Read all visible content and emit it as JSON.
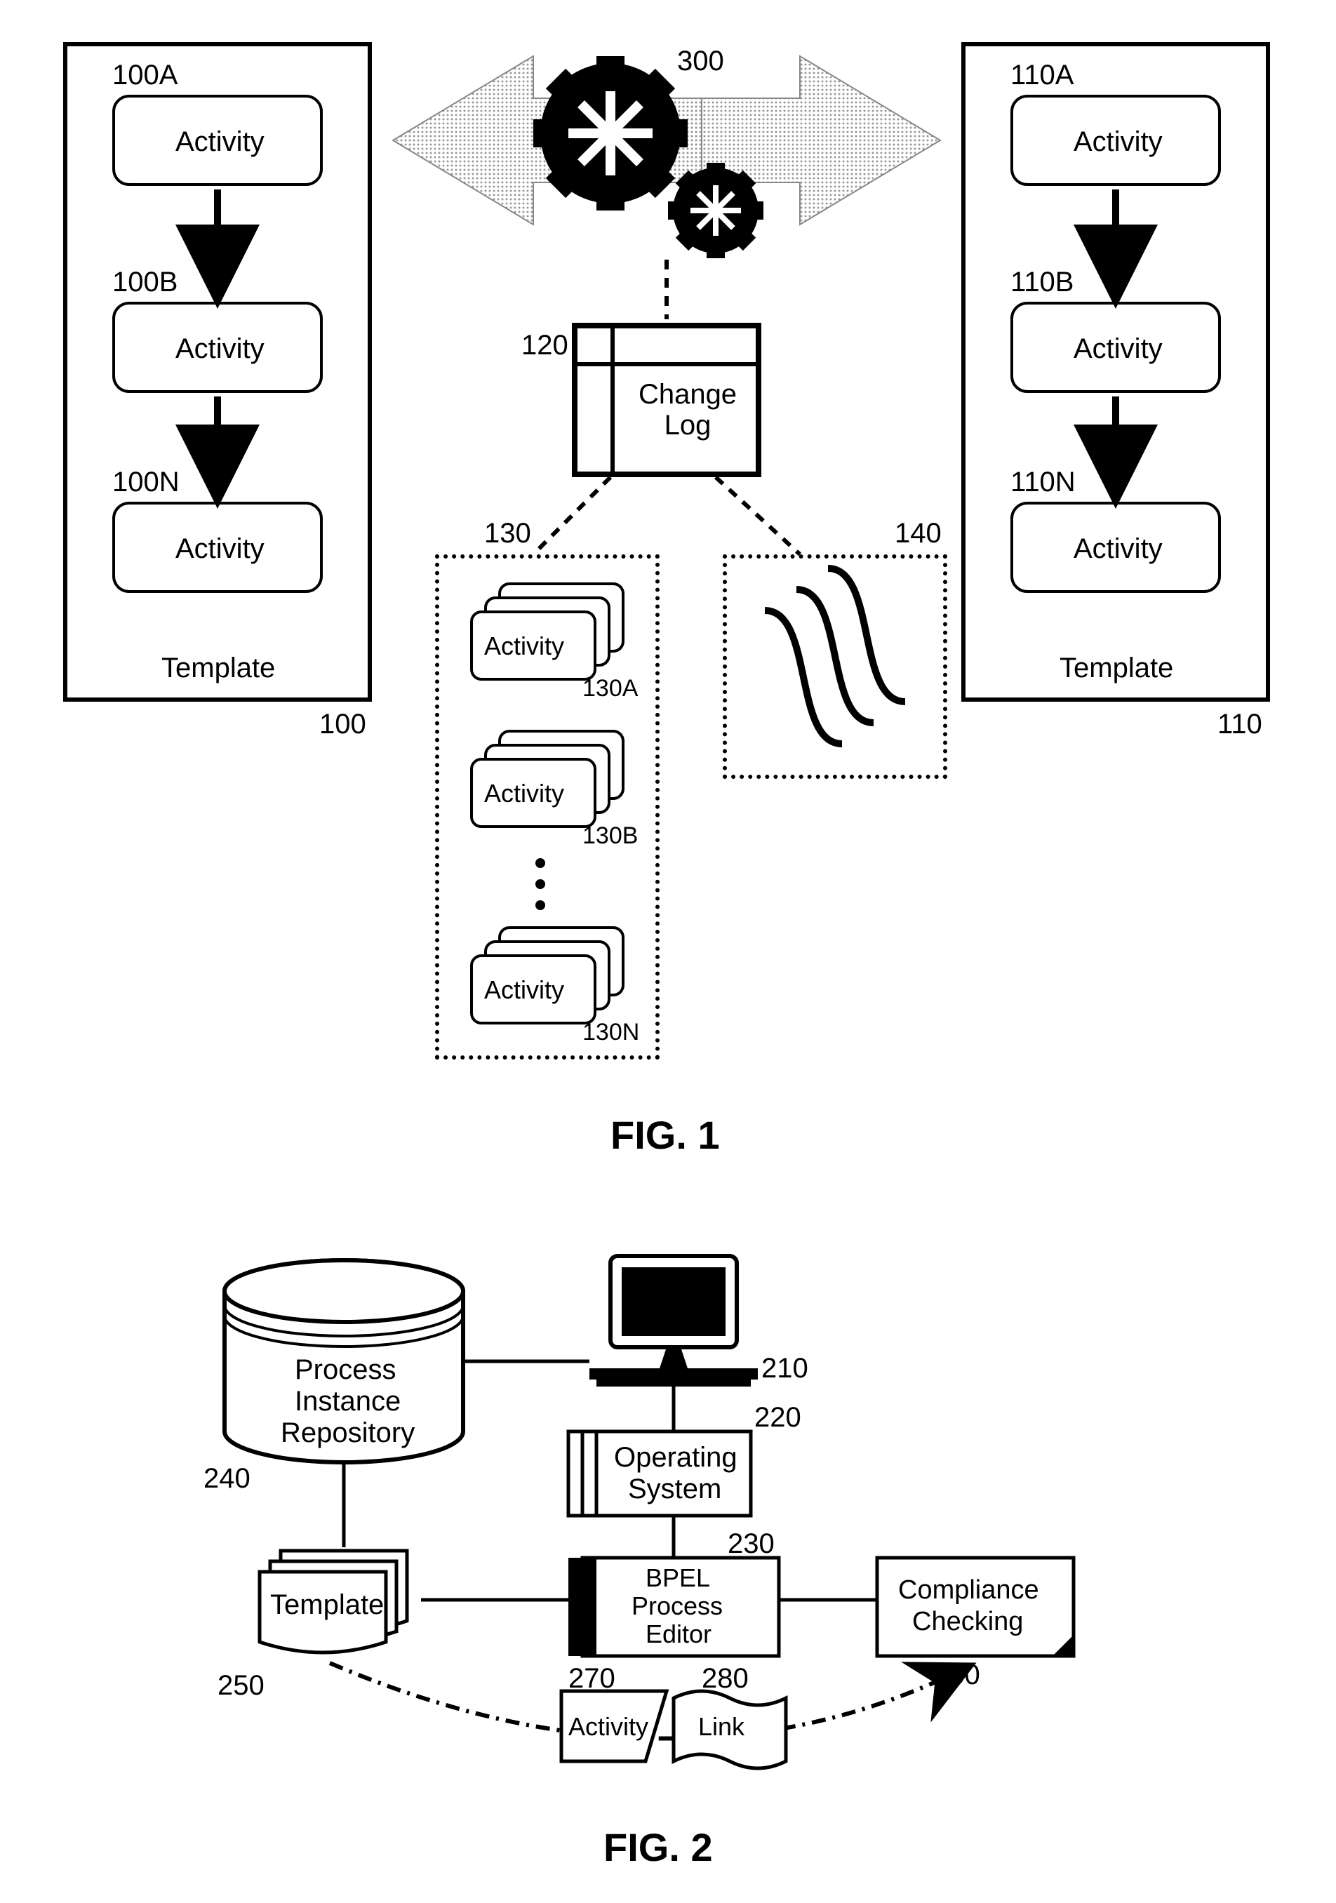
{
  "fig1": {
    "caption": "FIG. 1",
    "left_template": {
      "label_top": "100A",
      "label_mid": "100B",
      "label_bot": "100N",
      "activity": "Activity",
      "footer": "Template",
      "ref": "100"
    },
    "right_template": {
      "label_top": "110A",
      "label_mid": "110B",
      "label_bot": "110N",
      "activity": "Activity",
      "footer": "Template",
      "ref": "110"
    },
    "gears_ref": "300",
    "change_log": {
      "ref": "120",
      "label": "Change Log"
    },
    "stack_box": {
      "ref": "130",
      "items": [
        "Activity",
        "Activity",
        "Activity"
      ],
      "item_refs": [
        "130A",
        "130B",
        "130N"
      ]
    },
    "waves_ref": "140"
  },
  "fig2": {
    "caption": "FIG. 2",
    "repo": {
      "label_l1": "Process",
      "label_l2": "Instance",
      "label_l3": "Repository",
      "ref": "240"
    },
    "template": {
      "label": "Template",
      "ref": "250"
    },
    "computer_ref": "210",
    "os": {
      "label_l1": "Operating",
      "label_l2": "System",
      "ref": "220"
    },
    "editor": {
      "label_l1": "BPEL",
      "label_l2": "Process",
      "label_l3": "Editor",
      "ref": "230"
    },
    "compliance": {
      "label_l1": "Compliance",
      "label_l2": "Checking",
      "ref": "260"
    },
    "activity": {
      "label": "Activity",
      "ref": "270"
    },
    "link": {
      "label": "Link",
      "ref": "280"
    }
  }
}
